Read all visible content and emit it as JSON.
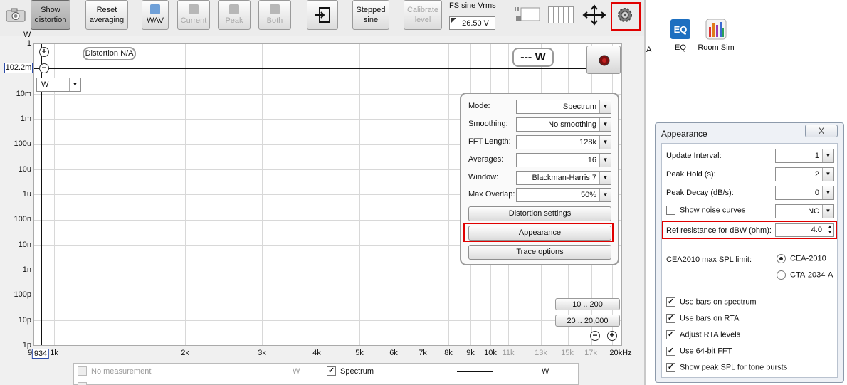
{
  "toolbar": {
    "show_distortion": "Show\ndistortion",
    "reset_averaging": "Reset\naveraging",
    "wav": "WAV",
    "current": "Current",
    "peak": "Peak",
    "both": "Both",
    "stepped_sine": "Stepped\nsine",
    "calibrate_level": "Calibrate\nlevel",
    "fs_sine_label": "FS sine Vrms",
    "fs_sine_value": "26.50 V"
  },
  "graph": {
    "y_unit": "W",
    "y_labels": [
      "1",
      "10m",
      "1m",
      "100u",
      "10u",
      "1u",
      "100n",
      "10n",
      "1n",
      "100p",
      "10p",
      "1p"
    ],
    "cursor_value": "102.2m",
    "unit_select": "W",
    "distortion_badge": "Distortion N/A",
    "readout": "--- W",
    "x_labels": [
      "9",
      "1k",
      "2k",
      "3k",
      "4k",
      "5k",
      "6k",
      "7k",
      "8k",
      "9k",
      "10k",
      "11k",
      "13k",
      "15k",
      "17k",
      "20kHz"
    ],
    "x_muted": [
      "11k",
      "13k",
      "15k",
      "17k"
    ],
    "x_cursor": "934",
    "range1": "10 .. 200",
    "range2": "20 .. 20,000"
  },
  "controls": {
    "mode_label": "Mode:",
    "mode_value": "Spectrum",
    "smoothing_label": "Smoothing:",
    "smoothing_value": "No  smoothing",
    "fft_label": "FFT Length:",
    "fft_value": "128k",
    "averages_label": "Averages:",
    "averages_value": "16",
    "window_label": "Window:",
    "window_value": "Blackman-Harris 7",
    "overlap_label": "Max Overlap:",
    "overlap_value": "50%",
    "distortion_settings": "Distortion settings",
    "appearance": "Appearance",
    "trace_options": "Trace options"
  },
  "sidebar": {
    "partial_label": "A",
    "eq_label": "EQ",
    "roomsim_label": "Room Sim"
  },
  "appearance_dialog": {
    "title": "Appearance",
    "close": "X",
    "update_interval_label": "Update Interval:",
    "update_interval_value": "1",
    "peak_hold_label": "Peak Hold (s):",
    "peak_hold_value": "2",
    "peak_decay_label": "Peak Decay (dB/s):",
    "peak_decay_value": "0",
    "show_noise_label": "Show noise curves",
    "show_noise_value": "NC",
    "ref_resistance_label": "Ref resistance for dBW (ohm):",
    "ref_resistance_value": "4.0",
    "cea_label": "CEA2010 max SPL limit:",
    "cea_option1": "CEA-2010",
    "cea_option2": "CTA-2034-A",
    "use_bars_spectrum": "Use bars on spectrum",
    "use_bars_rta": "Use bars on RTA",
    "adjust_rta": "Adjust RTA levels",
    "use_64bit": "Use 64-bit FFT",
    "show_peak_spl": "Show peak SPL for tone bursts"
  },
  "legend": {
    "no_measurement": "No measurement",
    "no_measurement_unit": "W",
    "spectrum": "Spectrum",
    "spectrum_unit": "W"
  }
}
